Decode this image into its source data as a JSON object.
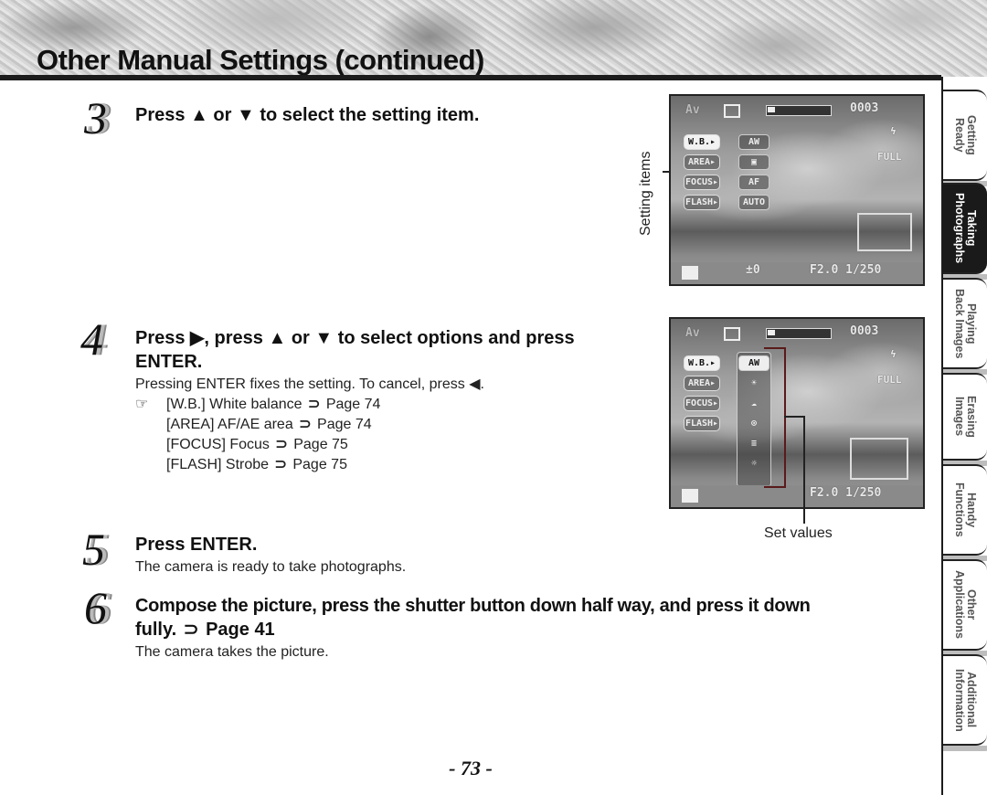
{
  "header": {
    "title": "Other Manual Settings (continued)"
  },
  "steps": [
    {
      "number": "3",
      "heading_parts": [
        "Press ",
        "▲",
        " or ",
        "▼",
        " to select the setting item."
      ]
    },
    {
      "number": "4",
      "heading_line1": "Press ▶, press ▲ or ▼ to select options and press",
      "heading_line2": "ENTER.",
      "body": "Pressing ENTER fixes the setting. To cancel, press ◀.",
      "references": [
        {
          "label": "[W.B.] White balance",
          "page": "Page 74"
        },
        {
          "label": "[AREA] AF/AE area",
          "page": "Page 74"
        },
        {
          "label": "[FOCUS] Focus",
          "page": "Page 75"
        },
        {
          "label": "[FLASH] Strobe",
          "page": "Page 75"
        }
      ]
    },
    {
      "number": "5",
      "heading": "Press ENTER.",
      "body": "The camera is ready to take photographs."
    },
    {
      "number": "6",
      "heading_line1": "Compose the picture, press the shutter button down half way, and press it down",
      "heading_line2_text": "fully.",
      "heading_line2_page": "Page 41",
      "body": "The camera takes the picture."
    }
  ],
  "icons": {
    "reference": "☞",
    "page_arrow": "⊃"
  },
  "lcd1": {
    "mode": "Av",
    "counter": "0003",
    "menu_items": [
      "W.B.▸",
      "AREA▸",
      "FOCUS▸",
      "FLASH▸"
    ],
    "menu_values": [
      "AW",
      "▣",
      "AF",
      "AUTO"
    ],
    "quality": "FULL",
    "exposure": "±0",
    "aperture_shutter": "F2.0  1/250"
  },
  "lcd2": {
    "mode": "Av",
    "counter": "0003",
    "menu_items": [
      "W.B.▸",
      "AREA▸",
      "FOCUS▸",
      "FLASH▸"
    ],
    "value_options": [
      "AW",
      "☀",
      "☁",
      "⊙",
      "≡",
      "☼"
    ],
    "quality": "FULL",
    "aperture_shutter": "F2.0  1/250"
  },
  "callouts": {
    "setting_items": "Setting items",
    "set_values": "Set values"
  },
  "side_tabs": [
    {
      "label": "Getting\nReady",
      "active": false
    },
    {
      "label": "Taking\nPhotographs",
      "active": true
    },
    {
      "label": "Playing\nBack Images",
      "active": false
    },
    {
      "label": "Erasing\nImages",
      "active": false
    },
    {
      "label": "Handy\nFunctions",
      "active": false
    },
    {
      "label": "Other\nApplications",
      "active": false
    },
    {
      "label": "Additional\nInformation",
      "active": false
    }
  ],
  "page_number": "- 73 -"
}
